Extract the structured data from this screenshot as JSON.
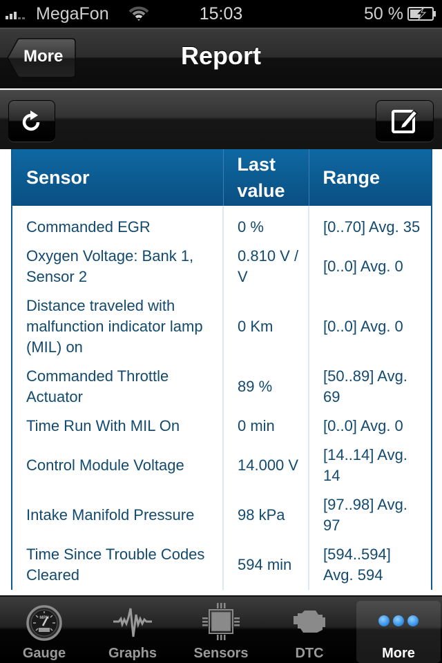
{
  "status_bar": {
    "carrier": "MegaFon",
    "time": "15:03",
    "battery_percent": "50 %",
    "signal_bars_filled": 3,
    "signal_bars_total": 5,
    "battery_charging": true
  },
  "nav": {
    "back_label": "More",
    "title": "Report"
  },
  "toolbar": {
    "refresh_icon": "refresh-icon",
    "compose_icon": "compose-icon"
  },
  "table": {
    "headers": [
      "Sensor",
      "Last value",
      "Range"
    ],
    "header_last_line1": "Last",
    "header_last_line2": "value",
    "rows": [
      {
        "sensor": "Commanded EGR",
        "last_value": "0 %",
        "range": "[0..70] Avg. 35"
      },
      {
        "sensor": "Oxygen Voltage: Bank 1, Sensor 2",
        "last_value": "0.810 V / V",
        "range": "[0..0] Avg. 0"
      },
      {
        "sensor": "Distance traveled with malfunction indicator lamp (MIL) on",
        "last_value": "0 Km",
        "range": "[0..0] Avg. 0"
      },
      {
        "sensor": "Commanded Throttle Actuator",
        "last_value": "89 %",
        "range": "[50..89] Avg. 69"
      },
      {
        "sensor": "Time Run With MIL On",
        "last_value": "0 min",
        "range": "[0..0] Avg. 0"
      },
      {
        "sensor": "Control Module Voltage",
        "last_value": "14.000 V",
        "range": "[14..14] Avg. 14"
      },
      {
        "sensor": "Intake Manifold Pressure",
        "last_value": "98 kPa",
        "range": "[97..98] Avg. 97"
      },
      {
        "sensor": "Time Since Trouble Codes Cleared",
        "last_value": "594 min",
        "range": "[594..594] Avg. 594"
      }
    ]
  },
  "tab_bar": {
    "tabs": [
      {
        "label": "Gauge",
        "icon": "gauge-icon",
        "active": false
      },
      {
        "label": "Graphs",
        "icon": "graph-wave-icon",
        "active": false
      },
      {
        "label": "Sensors",
        "icon": "chip-icon",
        "active": false
      },
      {
        "label": "DTC",
        "icon": "engine-icon",
        "active": false
      },
      {
        "label": "More",
        "icon": "more-dots-icon",
        "active": true
      }
    ],
    "colors": {
      "active_dots": "#3a9cf0",
      "inactive_label": "#9a9a9a",
      "active_label": "#ffffff"
    }
  },
  "colors": {
    "table_header": "#0c5c94",
    "table_text": "#114a6e",
    "table_divider": "#dde9f2"
  }
}
